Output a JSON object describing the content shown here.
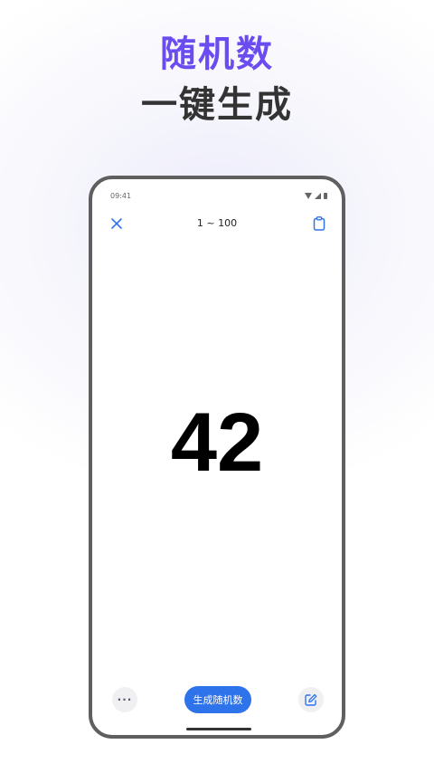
{
  "promo": {
    "title_line1": "随机数",
    "title_line2": "一键生成"
  },
  "status_bar": {
    "time": "09:41"
  },
  "toolbar": {
    "range_label": "1 ~ 100"
  },
  "result": {
    "number": "42"
  },
  "bottom_bar": {
    "more_label": "···",
    "generate_label": "生成随机数"
  },
  "colors": {
    "accent_blue": "#2f73eb",
    "headline_purple": "#6b4cf0",
    "headline_dark": "#333333"
  },
  "icons": {
    "close": "close-icon",
    "clipboard": "clipboard-icon",
    "more": "more-icon",
    "edit": "edit-icon"
  }
}
